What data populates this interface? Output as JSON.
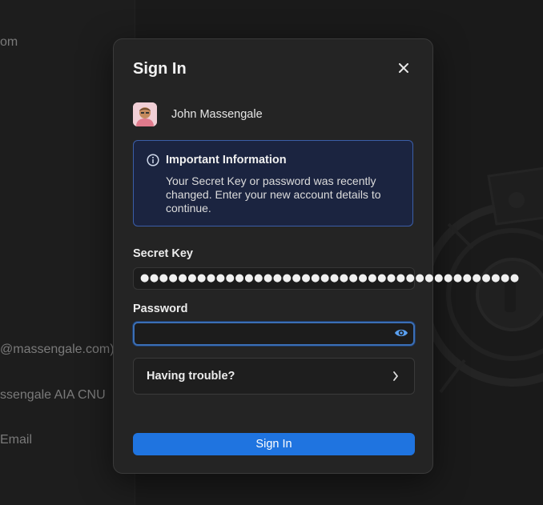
{
  "background": {
    "sidebar_texts": [
      "om",
      "@massengale.com)",
      "ssengale AIA CNU",
      "Email"
    ]
  },
  "modal": {
    "title": "Sign In",
    "close_icon": "close-icon",
    "account": {
      "name": "John Massengale",
      "avatar_icon": "avatar"
    },
    "info": {
      "icon": "info-icon",
      "title": "Important Information",
      "text": "Your Secret Key or password was recently changed. Enter your new account details to continue."
    },
    "secret_key": {
      "label": "Secret Key",
      "value": "●●●●●●●●●●●●●●●●●●●●●●●●●●●●●●●●●●●●●●●●"
    },
    "password": {
      "label": "Password",
      "value": "",
      "reveal_icon": "eye-icon"
    },
    "trouble": {
      "label": "Having trouble?",
      "icon": "chevron-right-icon"
    },
    "sign_in_label": "Sign In"
  },
  "colors": {
    "accent": "#1f74e0",
    "info_border": "#3b5ea8",
    "info_bg": "#1b2440",
    "focus_ring": "#3b6fb6"
  }
}
